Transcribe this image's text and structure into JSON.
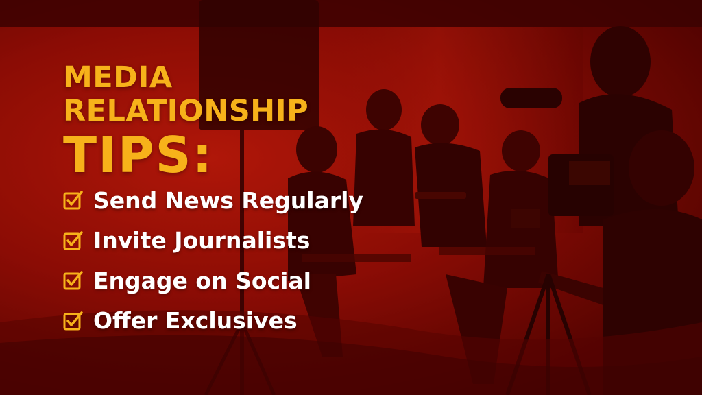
{
  "title": {
    "line1": "MEDIA",
    "line2": "RELATIONSHIP",
    "line3": "TIPS:"
  },
  "tips": [
    {
      "label": "Send News Regularly",
      "icon": "checkbox-checked-icon"
    },
    {
      "label": "Invite Journalists",
      "icon": "checkbox-checked-icon"
    },
    {
      "label": "Engage on Social",
      "icon": "checkbox-checked-icon"
    },
    {
      "label": "Offer Exclusives",
      "icon": "checkbox-checked-icon"
    }
  ],
  "colors": {
    "accent": "#f7b21a",
    "text": "#ffffff",
    "background": "#8c0d05"
  }
}
